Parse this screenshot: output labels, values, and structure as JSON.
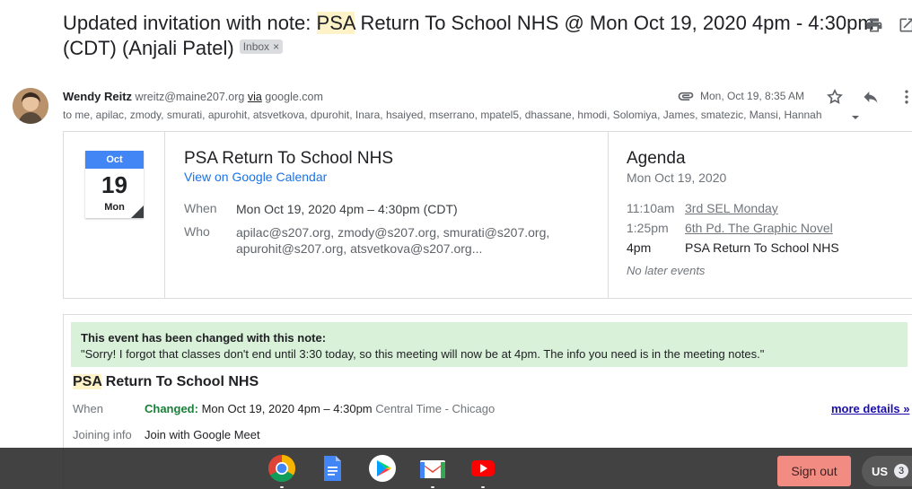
{
  "email": {
    "subject_prefix": "Updated invitation with note: ",
    "subject_highlight": "PSA",
    "subject_rest": " Return To School NHS @ Mon Oct 19, 2020 4pm - 4:30pm (CDT) (Anjali Patel)",
    "label": "Inbox",
    "label_close": "×",
    "sender_name": "Wendy Reitz",
    "sender_email": "wreitz@maine207.org",
    "via_text": "via",
    "via_domain": "google.com",
    "date": "Mon, Oct 19, 8:35 AM",
    "recipients": "to me, apilac, zmody, smurati, apurohit, atsvetkova, dpurohit, Inara, hsaiyed, mserrano, mpatel5, dhassane, hmodi, Solomiya, James, smatezic, Mansi, Hannah"
  },
  "calendar_card": {
    "month": "Oct",
    "day": "19",
    "weekday": "Mon",
    "event_title": "PSA Return To School NHS",
    "view_link": "View on Google Calendar",
    "when_label": "When",
    "when_value": "Mon Oct 19, 2020 4pm – 4:30pm (CDT)",
    "who_label": "Who",
    "who_line1_a": "apilac@s207.org",
    "who_line1_b": "zmody@s207.org",
    "who_line1_c": "smurati@s207.org,",
    "who_line2_a": "apurohit@s207.org",
    "who_line2_b": "atsvetkova@s207.org...",
    "agenda_title": "Agenda",
    "agenda_date": "Mon Oct 19, 2020",
    "agenda": [
      {
        "time": "11:10am",
        "title": "3rd SEL Monday"
      },
      {
        "time": "1:25pm",
        "title": "6th Pd. The Graphic Novel"
      },
      {
        "time": "4pm",
        "title": "PSA Return To School NHS"
      }
    ],
    "no_later": "No later events"
  },
  "invitation": {
    "note_heading": "This event has been changed with this note:",
    "note_text": "\"Sorry! I forgot that classes don't end until 3:30 today, so this meeting will now be at 4pm. The info you need is in the meeting notes.\"",
    "title_highlight": "PSA",
    "title_rest": " Return To School NHS",
    "when_label": "When",
    "changed_label": "Changed:",
    "when_value": "Mon Oct 19, 2020 4pm – 4:30pm",
    "timezone": "Central Time - Chicago",
    "more_details": "more details »",
    "joining_label": "Joining info",
    "joining_value": "Join with Google Meet"
  },
  "shelf": {
    "apps": [
      "chrome-icon",
      "docs-icon",
      "play-store-icon",
      "gmail-icon",
      "youtube-icon"
    ],
    "sign_out": "Sign out",
    "input_lang": "US",
    "notification_count": "3"
  }
}
